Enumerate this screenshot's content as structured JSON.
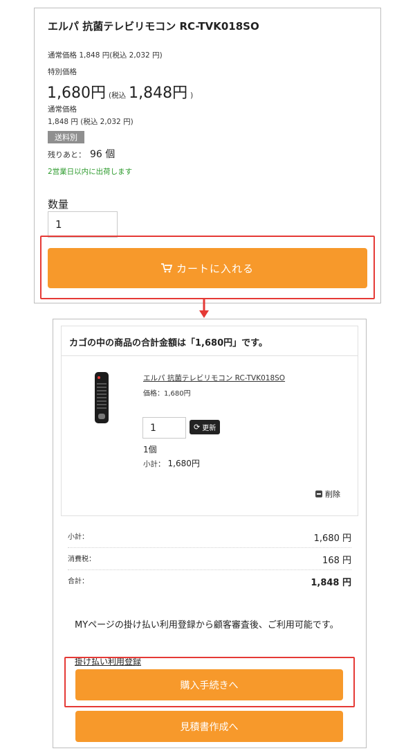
{
  "product": {
    "title": "エルパ 抗菌テレビリモコン RC-TVK018SO",
    "normal_price_line": "通常価格 1,848 円(税込 2,032 円)",
    "special_price_label": "特別価格",
    "special_price_main": "1,680円",
    "special_price_tax_prefix": "(税込",
    "special_price_tax_value": "1,848円",
    "special_price_tax_suffix": ")",
    "normal_label": "通常価格",
    "normal_value_line": "1,848 円 (税込 2,032 円)",
    "shipping_badge": "送料別",
    "stock_label": "残りあと：",
    "stock_count": "96 個",
    "ship_note": "2営業日以内に出荷します",
    "quantity_label": "数量",
    "quantity_value": "1",
    "add_to_cart": "カートに入れる"
  },
  "cart": {
    "header": "カゴの中の商品の合計金額は「1,680円」です。",
    "item_name": "エルパ 抗菌テレビリモコン RC-TVK018SO",
    "item_price": "価格：1,680円",
    "item_qty": "1",
    "update_label": "更新",
    "qty_line": "1個",
    "subtotal_line_label": "小計：",
    "subtotal_line_value": "1,680円",
    "delete_label": "削除",
    "summary": [
      {
        "label": "小計：",
        "value": "1,680 円"
      },
      {
        "label": "消費税：",
        "value": "168 円"
      },
      {
        "label": "合計：",
        "value": "1,848 円"
      }
    ],
    "notice": "MYページの掛け払い利用登録から顧客審査後、ご利用可能です。",
    "register_link": "掛け払い利用登録",
    "checkout_button": "購入手続きへ",
    "estimate_button": "見積書作成へ"
  },
  "colors": {
    "accent": "#f7992b",
    "highlight": "#e53935"
  }
}
